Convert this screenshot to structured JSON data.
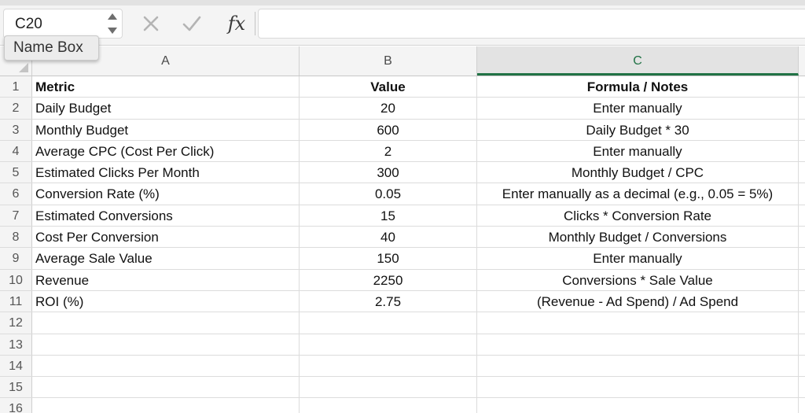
{
  "name_box": {
    "value": "C20",
    "tooltip": "Name Box"
  },
  "formula_bar": {
    "cancel_icon": "x-icon",
    "enter_icon": "check-icon",
    "fx_label": "fx",
    "value": ""
  },
  "colors": {
    "selected_column_accent": "#207245",
    "header_bg": "#f4f4f4",
    "grid_line": "#dcdcdc"
  },
  "columns": [
    "A",
    "B",
    "C"
  ],
  "selected_column": "C",
  "rows": [
    {
      "num": "1",
      "a": "Metric",
      "b": "Value",
      "c": "Formula / Notes"
    },
    {
      "num": "2",
      "a": "Daily Budget",
      "b": "20",
      "c": "Enter manually"
    },
    {
      "num": "3",
      "a": "Monthly Budget",
      "b": "600",
      "c": "Daily Budget * 30"
    },
    {
      "num": "4",
      "a": "Average CPC (Cost Per Click)",
      "b": "2",
      "c": "Enter manually"
    },
    {
      "num": "5",
      "a": "Estimated Clicks Per Month",
      "b": "300",
      "c": "Monthly Budget / CPC"
    },
    {
      "num": "6",
      "a": "Conversion Rate (%)",
      "b": "0.05",
      "c": "Enter manually as a decimal (e.g., 0.05 = 5%)"
    },
    {
      "num": "7",
      "a": "Estimated Conversions",
      "b": "15",
      "c": "Clicks * Conversion Rate"
    },
    {
      "num": "8",
      "a": "Cost Per Conversion",
      "b": "40",
      "c": "Monthly Budget / Conversions"
    },
    {
      "num": "9",
      "a": "Average Sale Value",
      "b": "150",
      "c": "Enter manually"
    },
    {
      "num": "10",
      "a": "Revenue",
      "b": "2250",
      "c": "Conversions * Sale Value"
    },
    {
      "num": "11",
      "a": "ROI (%)",
      "b": "2.75",
      "c": "(Revenue - Ad Spend) / Ad Spend"
    },
    {
      "num": "12",
      "a": "",
      "b": "",
      "c": ""
    },
    {
      "num": "13",
      "a": "",
      "b": "",
      "c": ""
    },
    {
      "num": "14",
      "a": "",
      "b": "",
      "c": ""
    },
    {
      "num": "15",
      "a": "",
      "b": "",
      "c": ""
    },
    {
      "num": "16",
      "a": "",
      "b": "",
      "c": ""
    }
  ]
}
